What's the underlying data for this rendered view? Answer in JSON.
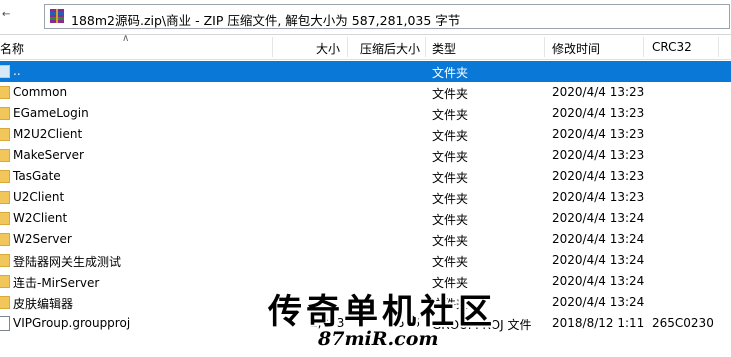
{
  "path_bar": {
    "path_text": "188m2源码.zip\\商业 - ZIP 压缩文件, 解包大小为 587,281,035 字节"
  },
  "columns": {
    "name": "名称",
    "size": "大小",
    "packed": "压缩后大小",
    "type": "类型",
    "modified": "修改时间",
    "crc": "CRC32"
  },
  "rows": [
    {
      "name": "..",
      "size": "",
      "packed": "",
      "type": "文件夹",
      "modified": "",
      "crc": "",
      "icon": "folder-icon"
    },
    {
      "name": "Common",
      "size": "",
      "packed": "",
      "type": "文件夹",
      "modified": "2020/4/4 13:23",
      "crc": "",
      "icon": "folder-icon"
    },
    {
      "name": "EGameLogin",
      "size": "",
      "packed": "",
      "type": "文件夹",
      "modified": "2020/4/4 13:23",
      "crc": "",
      "icon": "folder-icon"
    },
    {
      "name": "M2U2Client",
      "size": "",
      "packed": "",
      "type": "文件夹",
      "modified": "2020/4/4 13:23",
      "crc": "",
      "icon": "folder-icon"
    },
    {
      "name": "MakeServer",
      "size": "",
      "packed": "",
      "type": "文件夹",
      "modified": "2020/4/4 13:23",
      "crc": "",
      "icon": "folder-icon"
    },
    {
      "name": "TasGate",
      "size": "",
      "packed": "",
      "type": "文件夹",
      "modified": "2020/4/4 13:23",
      "crc": "",
      "icon": "folder-icon"
    },
    {
      "name": "U2Client",
      "size": "",
      "packed": "",
      "type": "文件夹",
      "modified": "2020/4/4 13:23",
      "crc": "",
      "icon": "folder-icon"
    },
    {
      "name": "W2Client",
      "size": "",
      "packed": "",
      "type": "文件夹",
      "modified": "2020/4/4 13:24",
      "crc": "",
      "icon": "folder-icon"
    },
    {
      "name": "W2Server",
      "size": "",
      "packed": "",
      "type": "文件夹",
      "modified": "2020/4/4 13:24",
      "crc": "",
      "icon": "folder-icon"
    },
    {
      "name": "登陆器网关生成测试",
      "size": "",
      "packed": "",
      "type": "文件夹",
      "modified": "2020/4/4 13:24",
      "crc": "",
      "icon": "folder-icon"
    },
    {
      "name": "连击-MirServer",
      "size": "",
      "packed": "",
      "type": "文件夹",
      "modified": "2020/4/4 13:24",
      "crc": "",
      "icon": "folder-icon"
    },
    {
      "name": "皮肤编辑器",
      "size": "",
      "packed": "",
      "type": "文件夹",
      "modified": "2020/4/4 13:24",
      "crc": "",
      "icon": "folder-icon"
    },
    {
      "name": "VIPGroup.groupproj",
      "size": "2,943",
      "packed": "596",
      "type": "GROUPPROJ 文件",
      "modified": "2018/8/12 1:11",
      "crc": "265C0230",
      "icon": "file-icon"
    }
  ],
  "selected_row": 0,
  "watermark": {
    "title": "传奇单机社区",
    "site": "87miR.com"
  },
  "colors": {
    "selection": "#0a78d7",
    "folder": "#f1c75b"
  }
}
